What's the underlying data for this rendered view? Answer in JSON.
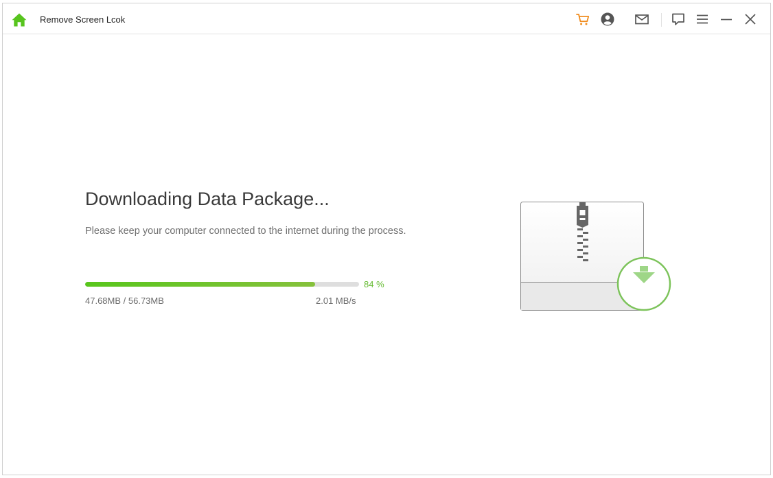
{
  "titlebar": {
    "title": "Remove Screen Lcok",
    "icons": [
      "home-icon",
      "cart-icon",
      "account-icon",
      "mail-icon",
      "feedback-icon",
      "menu-icon",
      "minimize-icon",
      "close-icon"
    ],
    "colors": {
      "home": "#57c41e",
      "cart": "#f08c1e",
      "icon": "#555555"
    }
  },
  "main": {
    "heading": "Downloading Data Package...",
    "subtext": "Please keep your computer connected to the internet during the process.",
    "progress": {
      "percent_value": 84,
      "percent_label": "84 %",
      "size_text": "47.68MB / 56.73MB",
      "speed_text": "2.01 MB/s",
      "fill_color": "#64c322",
      "track_color": "#dedede"
    },
    "illustration": {
      "icon": "zip-download-icon",
      "accent_color": "#7cc35a"
    }
  }
}
